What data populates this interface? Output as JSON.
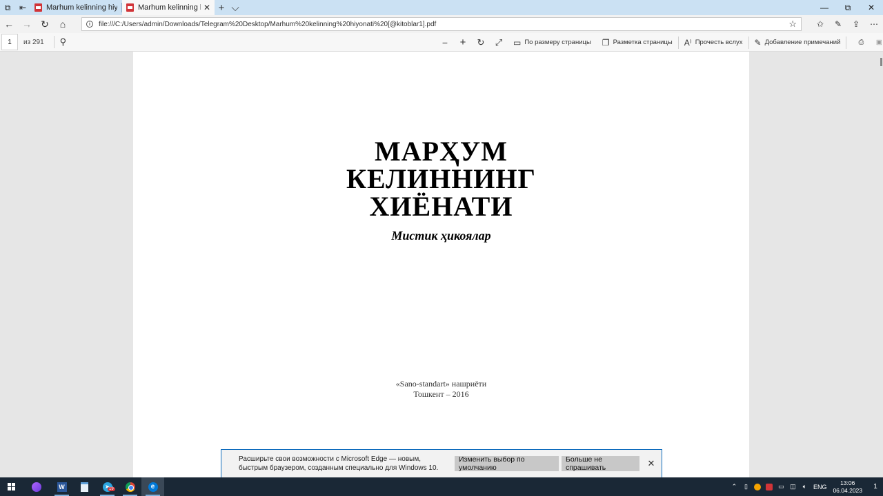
{
  "browser": {
    "tabs": [
      {
        "title": "Marhum kelinning hiyonati",
        "active": false
      },
      {
        "title": "Marhum kelinning hiyon",
        "active": true
      }
    ],
    "url": "file:///C:/Users/admin/Downloads/Telegram%20Desktop/Marhum%20kelinning%20hiyonati%20[@kitoblar1].pdf"
  },
  "pdf_toolbar": {
    "current_page": "1",
    "page_total": "из 291",
    "fit_page_label": "По размеру страницы",
    "page_layout_label": "Разметка страницы",
    "read_aloud_label": "Прочесть вслух",
    "add_notes_label": "Добавление примечаний"
  },
  "document": {
    "title_line1": "МАРҲУМ",
    "title_line2": "КЕЛИННИНГ",
    "title_line3": "ХИЁНАТИ",
    "subtitle": "Мистик ҳикоялар",
    "publisher": "«Sano-standart» нашриёти",
    "city_year": "Тошкент – 2016"
  },
  "notification": {
    "text": "Расширьте свои возможности с Microsoft Edge — новым, быстрым браузером, созданным специально для Windows 10.",
    "primary_button": "Изменить выбор по умолчанию",
    "secondary_button": "Больше не спрашивать"
  },
  "taskbar": {
    "telegram_badge": "19",
    "language": "ENG",
    "time": "13:06",
    "date": "06.04.2023",
    "notification_count": "1"
  },
  "colors": {
    "tab_bar": "#cbe1f3",
    "taskbar": "#1a2836",
    "accent": "#0f6cbd"
  }
}
